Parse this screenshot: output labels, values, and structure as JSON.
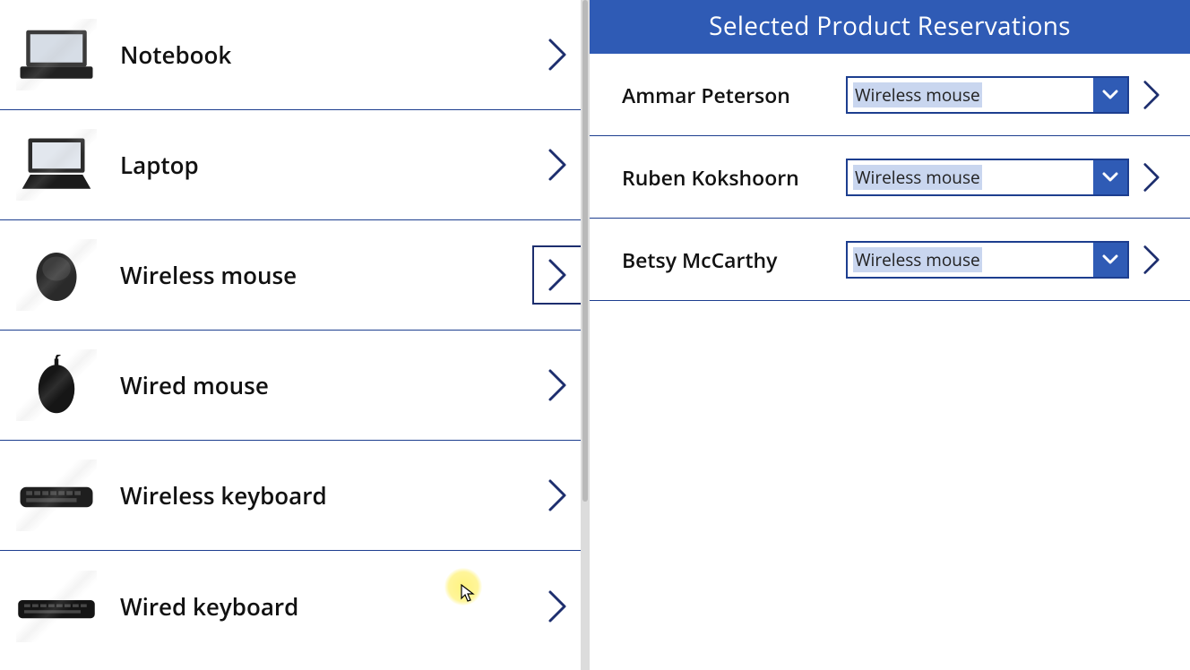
{
  "colors": {
    "brand": "#2f5bb5",
    "border": "#1d3e8f",
    "darkChevron": "#1d2e6e"
  },
  "products": [
    {
      "label": "Notebook",
      "icon": "notebook",
      "selected": false
    },
    {
      "label": "Laptop",
      "icon": "laptop",
      "selected": false
    },
    {
      "label": "Wireless mouse",
      "icon": "wireless-mouse",
      "selected": true
    },
    {
      "label": "Wired mouse",
      "icon": "wired-mouse",
      "selected": false
    },
    {
      "label": "Wireless keyboard",
      "icon": "wireless-keyboard",
      "selected": false
    },
    {
      "label": "Wired keyboard",
      "icon": "wired-keyboard",
      "selected": false
    }
  ],
  "rightPanel": {
    "title": "Selected Product Reservations",
    "reservations": [
      {
        "name": "Ammar Peterson",
        "product": "Wireless mouse"
      },
      {
        "name": "Ruben Kokshoorn",
        "product": "Wireless mouse"
      },
      {
        "name": "Betsy McCarthy",
        "product": "Wireless mouse"
      }
    ]
  }
}
